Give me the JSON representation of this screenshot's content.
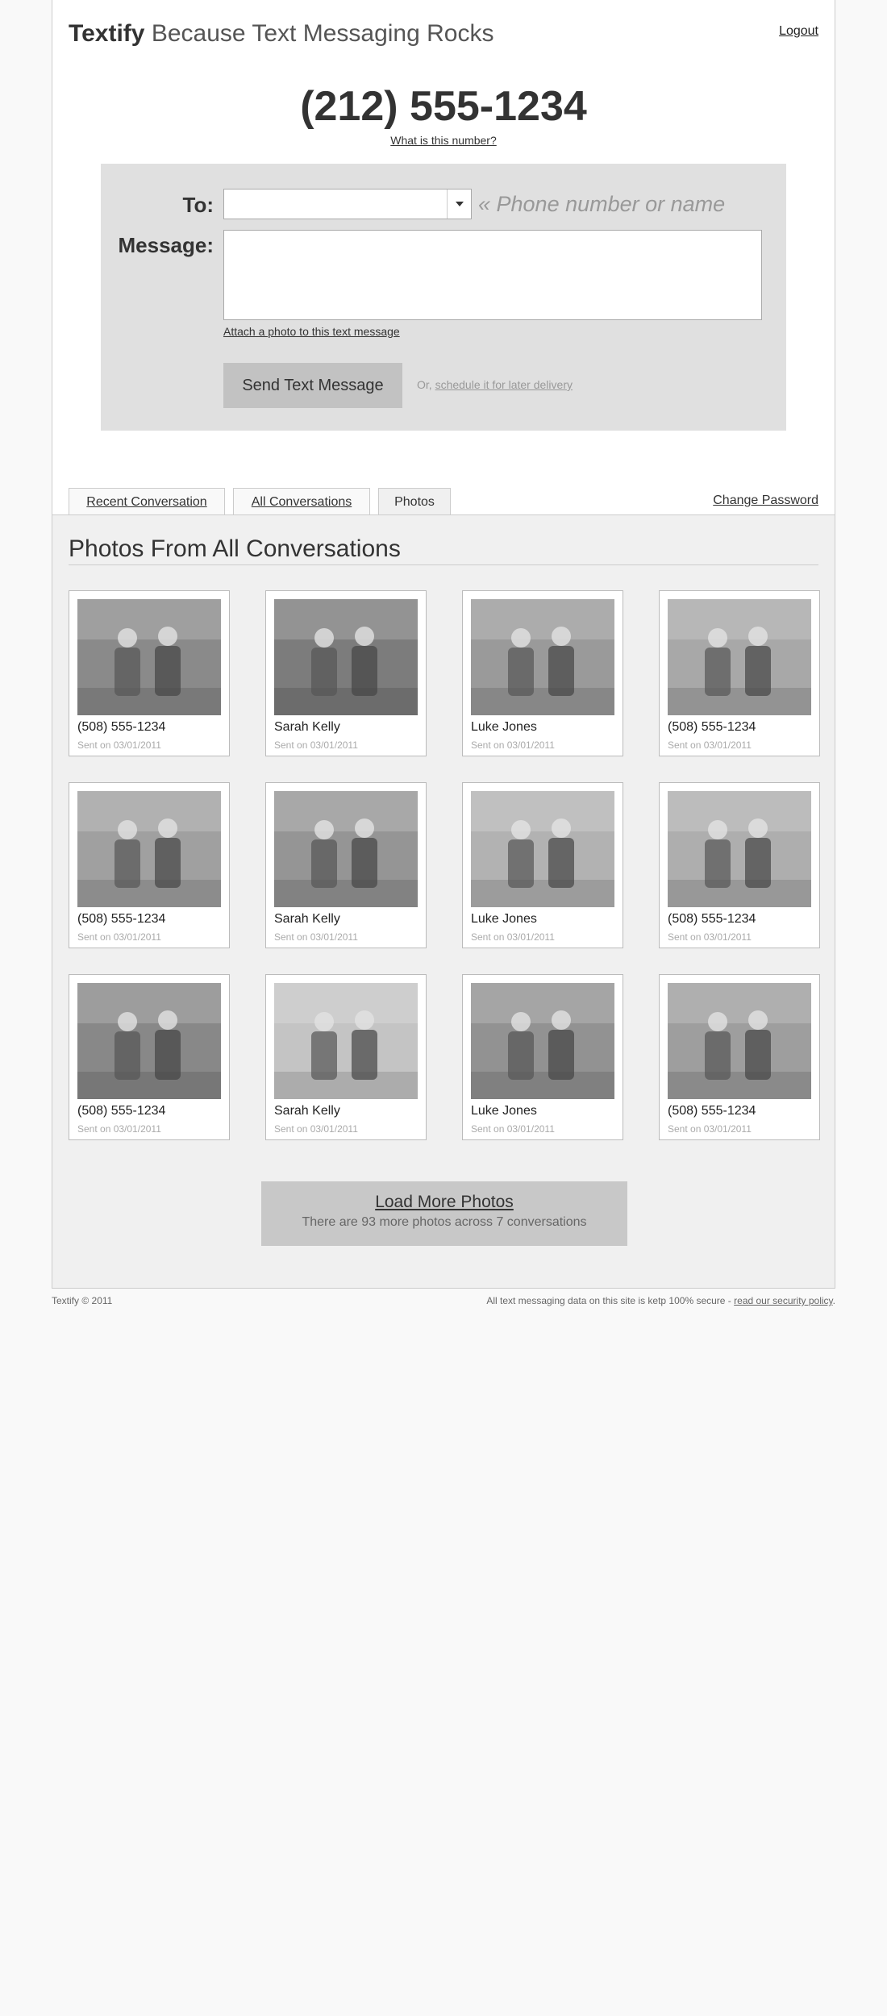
{
  "header": {
    "brand_name": "Textify",
    "tagline": "Because Text Messaging Rocks",
    "logout_label": "Logout"
  },
  "number": {
    "value": "(212) 555-1234",
    "help_link": "What is this number?"
  },
  "compose": {
    "to_label": "To:",
    "to_value": "",
    "to_hint": "« Phone number or name",
    "message_label": "Message:",
    "message_value": "",
    "attach_link": "Attach a photo to this text message",
    "send_button": "Send Text Message",
    "later_prefix": "Or,",
    "later_link": "schedule it for later delivery"
  },
  "tabs": {
    "recent": "Recent Conversation",
    "all": "All Conversations",
    "photos": "Photos",
    "change_password": "Change Password"
  },
  "photos_section": {
    "title": "Photos From All Conversations",
    "items": [
      {
        "sender": "(508) 555-1234",
        "sent": "Sent on 03/01/2011"
      },
      {
        "sender": "Sarah Kelly",
        "sent": "Sent on 03/01/2011"
      },
      {
        "sender": "Luke Jones",
        "sent": "Sent on 03/01/2011"
      },
      {
        "sender": "(508) 555-1234",
        "sent": "Sent on 03/01/2011"
      },
      {
        "sender": "(508) 555-1234",
        "sent": "Sent on 03/01/2011"
      },
      {
        "sender": "Sarah Kelly",
        "sent": "Sent on 03/01/2011"
      },
      {
        "sender": "Luke Jones",
        "sent": "Sent on 03/01/2011"
      },
      {
        "sender": "(508) 555-1234",
        "sent": "Sent on 03/01/2011"
      },
      {
        "sender": "(508) 555-1234",
        "sent": "Sent on 03/01/2011"
      },
      {
        "sender": "Sarah Kelly",
        "sent": "Sent on 03/01/2011"
      },
      {
        "sender": "Luke Jones",
        "sent": "Sent on 03/01/2011"
      },
      {
        "sender": "(508) 555-1234",
        "sent": "Sent on 03/01/2011"
      }
    ],
    "load_more_label": "Load More Photos",
    "load_more_sub": "There are 93 more photos across 7 conversations"
  },
  "footer": {
    "copyright": "Textify © 2011",
    "security_text": "All text messaging data on this site is ketp 100% secure -",
    "security_link": "read our security policy",
    "security_end": "."
  },
  "colors": {
    "topbar": "#333333",
    "compose_bg": "#e0e0e0",
    "content_bg": "#f0f0f0",
    "button_bg": "#c2c2c2"
  }
}
